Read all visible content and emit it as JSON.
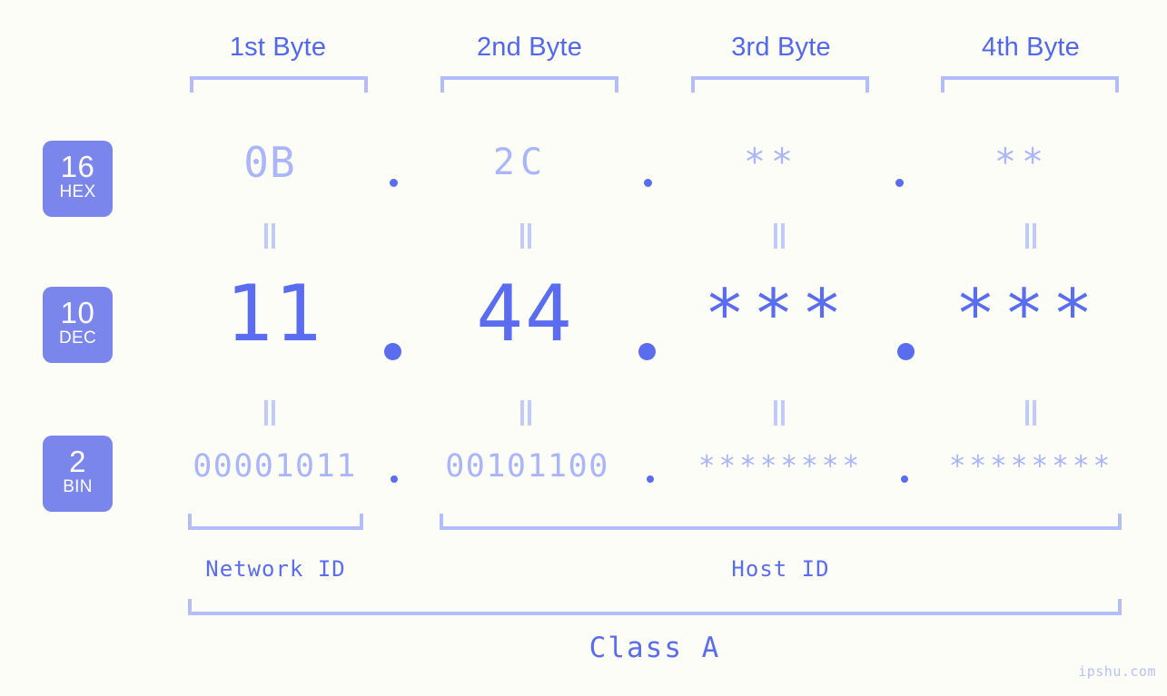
{
  "meta": {
    "background_color": "#fcfdf7",
    "accent_strong": "#5a6cf0",
    "accent_light": "#aab5fa",
    "badge_color": "#7b86ec"
  },
  "headers": [
    {
      "label": "1st Byte"
    },
    {
      "label": "2nd Byte"
    },
    {
      "label": "3rd Byte"
    },
    {
      "label": "4th Byte"
    }
  ],
  "bases": [
    {
      "number": "16",
      "name": "HEX"
    },
    {
      "number": "10",
      "name": "DEC"
    },
    {
      "number": "2",
      "name": "BIN"
    }
  ],
  "rows": {
    "hex": {
      "values": [
        "0B",
        "2C",
        "**",
        "**"
      ]
    },
    "dec": {
      "values": [
        "11",
        "44",
        "***",
        "***"
      ]
    },
    "bin": {
      "values": [
        "00001011",
        "00101100",
        "********",
        "********"
      ]
    }
  },
  "separators": {
    "symbol": ".",
    "count": 3
  },
  "equality": {
    "symbol": "=",
    "note": "rotated equals marks linking rows"
  },
  "sections": [
    {
      "label": "Network ID"
    },
    {
      "label": "Host ID"
    }
  ],
  "class": {
    "label": "Class A"
  },
  "watermark": {
    "text": "ipshu.com"
  }
}
